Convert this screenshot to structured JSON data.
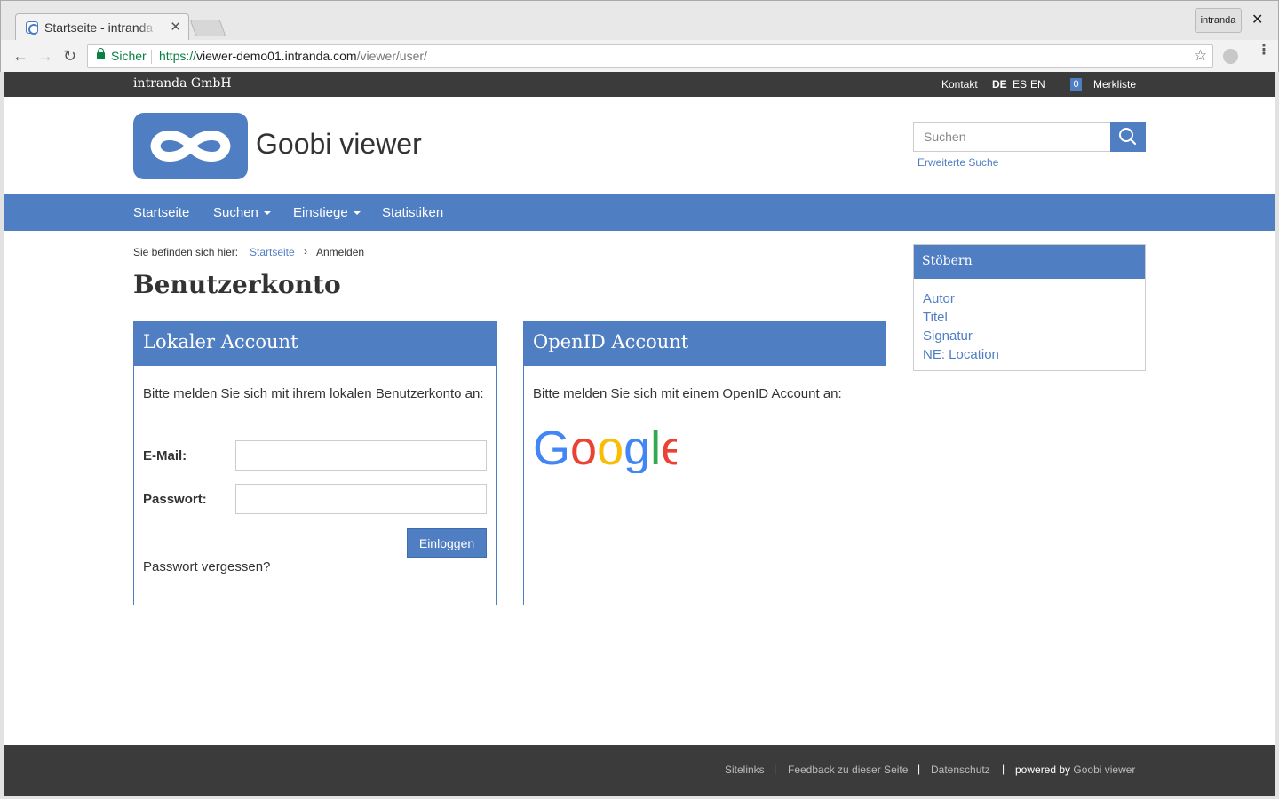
{
  "browser": {
    "tab_title": "Startseite - intranda",
    "profile_label": "intranda",
    "secure_label": "Sicher",
    "url_scheme": "https://",
    "url_host": "viewer-demo01.intranda.com",
    "url_path": "/viewer/user/"
  },
  "topbar": {
    "company": "intranda GmbH",
    "contact": "Kontakt",
    "languages": [
      "DE",
      "ES",
      "EN"
    ],
    "active_language": "DE",
    "bookmark_count": "0",
    "bookmark_label": "Merkliste"
  },
  "header": {
    "site_title": "Goobi viewer",
    "search_placeholder": "Suchen",
    "advanced_search": "Erweiterte Suche"
  },
  "nav": {
    "items": [
      "Startseite",
      "Suchen",
      "Einstiege",
      "Statistiken"
    ]
  },
  "breadcrumb": {
    "label": "Sie befinden sich hier:",
    "home": "Startseite",
    "separator": "›",
    "current": "Anmelden"
  },
  "page": {
    "title": "Benutzerkonto"
  },
  "local_account": {
    "heading": "Lokaler Account",
    "intro": "Bitte melden Sie sich mit ihrem lokalen Benutzerkonto an:",
    "email_label": "E-Mail:",
    "password_label": "Passwort:",
    "login_button": "Einloggen",
    "forgot_password": "Passwort vergessen?"
  },
  "openid_account": {
    "heading": "OpenID Account",
    "intro": "Bitte melden Sie sich mit einem OpenID Account an:",
    "provider": "Google"
  },
  "sidebar": {
    "heading": "Stöbern",
    "items": [
      "Autor",
      "Titel",
      "Signatur",
      "NE: Location"
    ]
  },
  "footer": {
    "links": [
      "Sitelinks",
      "Feedback zu dieser Seite",
      "Datenschutz"
    ],
    "powered_by": "powered by",
    "powered_link": "Goobi viewer"
  },
  "colors": {
    "brand": "#4f7ec3",
    "dark_bar": "#3b3b3b",
    "secure": "#0b8043"
  }
}
